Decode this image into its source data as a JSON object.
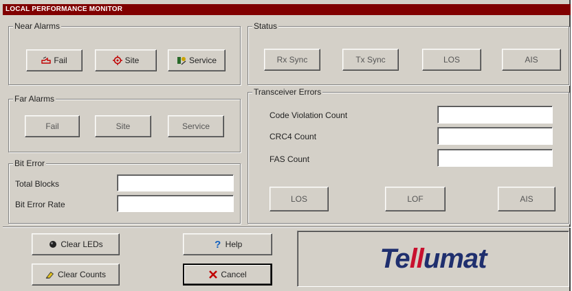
{
  "window": {
    "title": "LOCAL PERFORMANCE MONITOR"
  },
  "near_alarms": {
    "label": "Near Alarms",
    "buttons": [
      {
        "label": "Fail",
        "icon": "fail-icon"
      },
      {
        "label": "Site",
        "icon": "site-icon"
      },
      {
        "label": "Service",
        "icon": "service-icon"
      }
    ]
  },
  "far_alarms": {
    "label": "Far Alarms",
    "buttons": [
      {
        "label": "Fail"
      },
      {
        "label": "Site"
      },
      {
        "label": "Service"
      }
    ]
  },
  "bit_error": {
    "label": "Bit Error",
    "total_blocks_label": "Total Blocks",
    "total_blocks_value": "",
    "bit_error_rate_label": "Bit Error Rate",
    "bit_error_rate_value": ""
  },
  "status": {
    "label": "Status",
    "buttons": [
      {
        "label": "Rx Sync"
      },
      {
        "label": "Tx Sync"
      },
      {
        "label": "LOS"
      },
      {
        "label": "AIS"
      }
    ]
  },
  "transceiver_errors": {
    "label": "Transceiver Errors",
    "code_violation_label": "Code Violation Count",
    "code_violation_value": "",
    "crc4_label": "CRC4 Count",
    "crc4_value": "",
    "fas_label": "FAS Count",
    "fas_value": "",
    "buttons": [
      {
        "label": "LOS"
      },
      {
        "label": "LOF"
      },
      {
        "label": "AIS"
      }
    ]
  },
  "actions": {
    "clear_leds": "Clear LEDs",
    "clear_counts": "Clear Counts",
    "help": "Help",
    "cancel": "Cancel"
  },
  "logo": {
    "pre": "Te",
    "mid": "ll",
    "post": "umat"
  },
  "colors": {
    "title_bar": "#800000",
    "logo_blue": "#1f2f6e",
    "logo_red": "#c8102e",
    "face": "#d4d0c8"
  }
}
